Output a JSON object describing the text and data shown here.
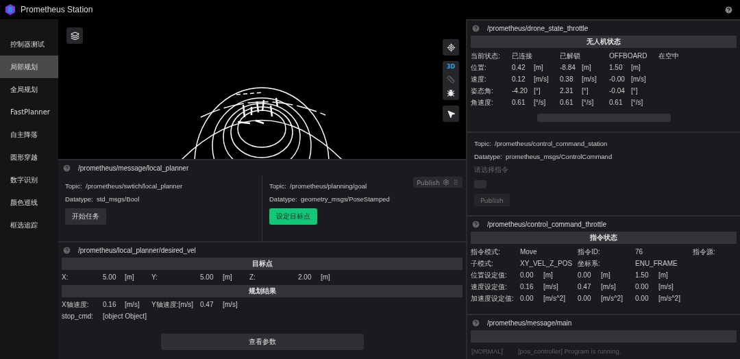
{
  "app": {
    "title": "Prometheus Station"
  },
  "sidebar": {
    "items": [
      {
        "label": "控制器测试",
        "selected": false
      },
      {
        "label": "局部规划",
        "selected": true
      },
      {
        "label": "全局规划",
        "selected": false
      },
      {
        "label": "FastPlanner",
        "selected": false
      },
      {
        "label": "自主降落",
        "selected": false
      },
      {
        "label": "圆形穿越",
        "selected": false
      },
      {
        "label": "数字识别",
        "selected": false
      },
      {
        "label": "颜色巡线",
        "selected": false
      },
      {
        "label": "框选追踪",
        "selected": false
      }
    ]
  },
  "map": {
    "view_mode": "3D"
  },
  "local_planner_panel": {
    "title": "/prometheus/message/local_planner",
    "publish_chip": "Publish",
    "publishers": [
      {
        "topic_label": "Topic:",
        "topic": "/prometheus/swtich/local_planner",
        "datatype_label": "Datatype:",
        "datatype": "std_msgs/Bool",
        "button": {
          "label": "开始任务",
          "kind": "default"
        }
      },
      {
        "topic_label": "Topic:",
        "topic": "/prometheus/planning/goal",
        "datatype_label": "Datatype:",
        "datatype": "geometry_msgs/PoseStamped",
        "button": {
          "label": "设定目标点",
          "kind": "primary"
        }
      }
    ]
  },
  "desired_vel_panel": {
    "title": "/prometheus/local_planner/desired_vel",
    "sections": [
      {
        "heading": "目标点",
        "rows": [
          [
            "X:",
            "5.00",
            "[m]",
            "Y:",
            "5.00",
            "[m]",
            "Z:",
            "2.00",
            "[m]"
          ]
        ]
      },
      {
        "heading": "规划结果",
        "rows": [
          [
            "X轴速度:",
            "0.16",
            "[m/s]",
            "Y轴速度:[m/s]",
            "0.47",
            "[m/s]"
          ],
          [
            "stop_cmd:",
            "[object Object]"
          ]
        ]
      }
    ],
    "button": "查看参数"
  },
  "drone_state_panel": {
    "title": "/prometheus/drone_state_throttle",
    "heading": "无人机状态",
    "rows": [
      [
        "当前状态:",
        "已连接",
        "",
        "已解锁",
        "",
        "OFFBOARD",
        "",
        "在空中"
      ],
      [
        "位置:",
        "0.42",
        "[m]",
        "-8.84",
        "[m]",
        "1.50",
        "[m]"
      ],
      [
        "速度:",
        "0.12",
        "[m/s]",
        "0.38",
        "[m/s]",
        "-0.00",
        "[m/s]"
      ],
      [
        "姿态角:",
        "-4.20",
        "[°]",
        "2.31",
        "[°]",
        "-0.04",
        "[°]"
      ],
      [
        "角速度:",
        "0.61",
        "[°/s]",
        "0.61",
        "[°/s]",
        "0.61",
        "[°/s]"
      ]
    ]
  },
  "command_station_panel": {
    "topic_label": "Topic:",
    "topic": "/prometheus/control_command_station",
    "datatype_label": "Datatype:",
    "datatype": "prometheus_msgs/ControlCommand",
    "select_label": "请选择指令",
    "publish_button": "Publish"
  },
  "command_throttle_panel": {
    "title": "/prometheus/control_command_throttle",
    "heading": "指令状态",
    "rows": [
      [
        "指令模式:",
        "Move",
        "",
        "指令ID:",
        "",
        "76",
        "",
        "指令源:"
      ],
      [
        "子模式:",
        "XY_VEL_Z_POS",
        "",
        "坐标系:",
        "",
        "ENU_FRAME"
      ],
      [
        "位置设定值:",
        "0.00",
        "[m]",
        "0.00",
        "[m]",
        "1.50",
        "[m]"
      ],
      [
        "速度设定值:",
        "0.16",
        "[m/s]",
        "0.47",
        "[m/s]",
        "0.00",
        "[m/s]"
      ],
      [
        "加速度设定值:",
        "0.00",
        "[m/s^2]",
        "0.00",
        "[m/s^2]",
        "0.00",
        "[m/s^2]"
      ]
    ]
  },
  "main_message_panel": {
    "title": "/prometheus/message/main",
    "logs": [
      {
        "level": "[NORMAL]",
        "text": "[pos_controller] Program is running."
      }
    ]
  }
}
